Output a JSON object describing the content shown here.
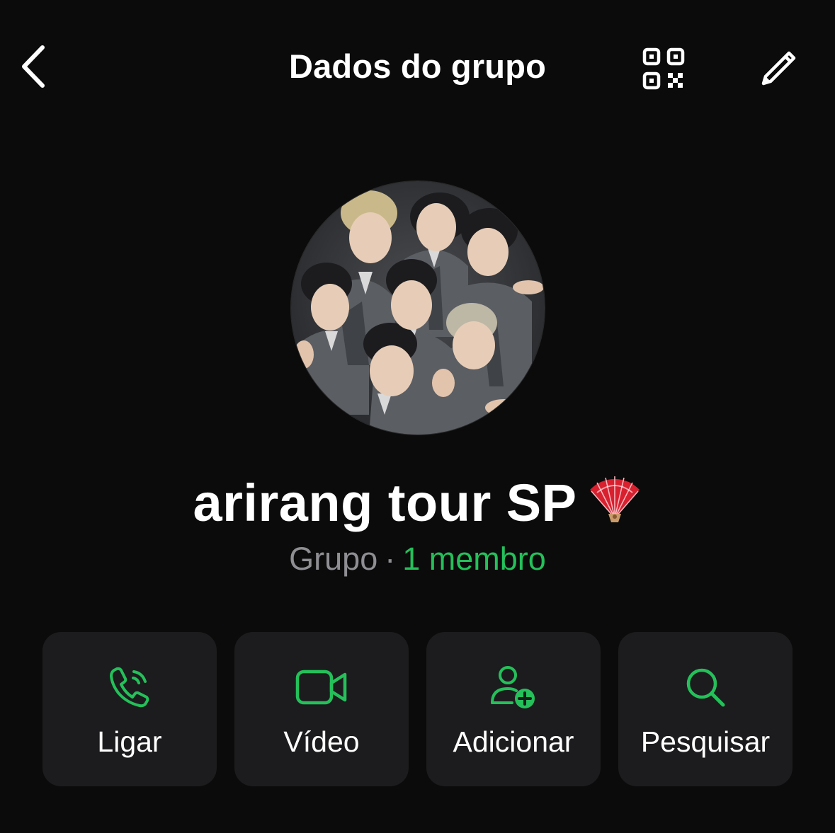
{
  "header": {
    "title": "Dados do grupo",
    "back_icon": "chevron-left-icon",
    "qr_icon": "qr-code-icon",
    "edit_icon": "pencil-icon"
  },
  "group": {
    "name": "arirang tour SP",
    "name_emoji": "folding-fan-icon",
    "type": "Grupo",
    "separator": "·",
    "members": "1 membro"
  },
  "actions": [
    {
      "label": "Ligar",
      "icon": "phone-icon"
    },
    {
      "label": "Vídeo",
      "icon": "video-camera-icon"
    },
    {
      "label": "Adicionar",
      "icon": "add-person-icon"
    },
    {
      "label": "Pesquisar",
      "icon": "search-icon"
    }
  ],
  "colors": {
    "background": "#0b0b0b",
    "card": "#1c1c1e",
    "accent_green": "#25c05a",
    "secondary_text": "#8e8e93",
    "primary_text": "#ffffff"
  }
}
